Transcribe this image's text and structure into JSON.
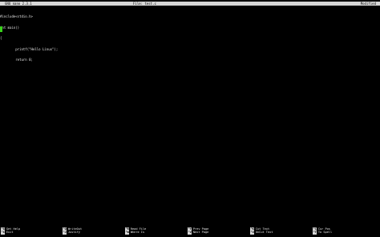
{
  "titlebar": {
    "app": "GNU nano 2.3.1",
    "file": "File: test.c",
    "status": "Modified"
  },
  "editor": {
    "lines": [
      "#include<stdio.h>",
      "int main()",
      "{",
      "        printf(\"Hello Linux\");",
      "        return 0;"
    ]
  },
  "shortcuts": [
    {
      "key": "^G",
      "label": "Get Help"
    },
    {
      "key": "^X",
      "label": "Exit"
    },
    {
      "key": "^O",
      "label": "WriteOut"
    },
    {
      "key": "^J",
      "label": "Justify"
    },
    {
      "key": "^R",
      "label": "Read File"
    },
    {
      "key": "^W",
      "label": "Where Is"
    },
    {
      "key": "^Y",
      "label": "Prev Page"
    },
    {
      "key": "^V",
      "label": "Next Page"
    },
    {
      "key": "^K",
      "label": "Cut Text"
    },
    {
      "key": "^U",
      "label": "UnCut Text"
    },
    {
      "key": "^C",
      "label": "Cur Pos"
    },
    {
      "key": "^T",
      "label": "To Spell"
    }
  ]
}
